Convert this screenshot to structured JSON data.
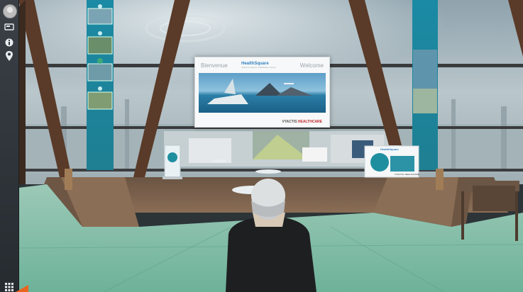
{
  "sidebar": {
    "icons": [
      {
        "name": "avatar-button",
        "icon": "user-avatar"
      },
      {
        "name": "chat-icon",
        "icon": "chat-bubble"
      },
      {
        "name": "info-icon",
        "icon": "info-circle"
      },
      {
        "name": "location-icon",
        "icon": "map-pin"
      },
      {
        "name": "grid-menu-icon",
        "icon": "grid"
      }
    ]
  },
  "banner": {
    "left_word": "Bienvenue",
    "right_word": "Welcome",
    "logo": "HealthSquare",
    "logo_tagline": "Virtual Congress & Exhibition Center",
    "footer_company": "VYACTIS",
    "footer_division": "HEALTHCARE"
  },
  "booth_sign": {
    "title": "HealthSquare",
    "footer": "VYACTIS ⁄ HEALTHCARE"
  },
  "colors": {
    "sidebar_bg": "#30363b",
    "floor": "#7fbfa8",
    "teal_panel": "#1f8fa0",
    "accent": "#e8651f"
  }
}
